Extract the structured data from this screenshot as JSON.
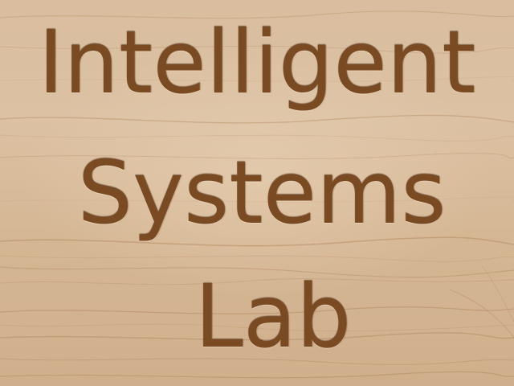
{
  "engraving": {
    "line1": "Intelligent",
    "line2": "Systems",
    "line3": "Lab"
  },
  "colors": {
    "wood": "#d8bc9c",
    "engraved_text": "#7a4a22",
    "grain": "#b8916a"
  }
}
